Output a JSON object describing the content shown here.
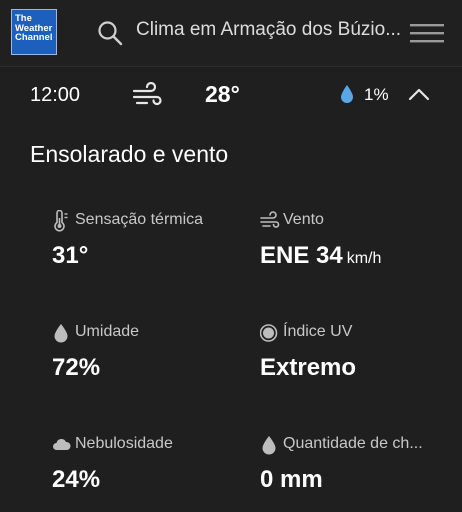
{
  "header": {
    "logo_lines": [
      "The",
      "Weather",
      "Channel"
    ],
    "search_text": "Clima em Armação dos Búzio..."
  },
  "hour": {
    "time": "12:00",
    "temperature": "28°",
    "precip_chance": "1%"
  },
  "condition": "Ensolarado e vento",
  "details": {
    "feels_like": {
      "label": "Sensação térmica",
      "value": "31°"
    },
    "wind": {
      "label": "Vento",
      "value": "ENE 34",
      "unit": "km/h"
    },
    "humidity": {
      "label": "Umidade",
      "value": "72%"
    },
    "uv_index": {
      "label": "Índice UV",
      "value": "Extremo"
    },
    "cloud_cover": {
      "label": "Nebulosidade",
      "value": "24%"
    },
    "rain_amount": {
      "label": "Quantidade de ch...",
      "value": "0 mm"
    }
  },
  "colors": {
    "background": "#1f1f1f",
    "logo_blue": "#1c5fbd",
    "rain_blue": "#5aa7e8"
  }
}
